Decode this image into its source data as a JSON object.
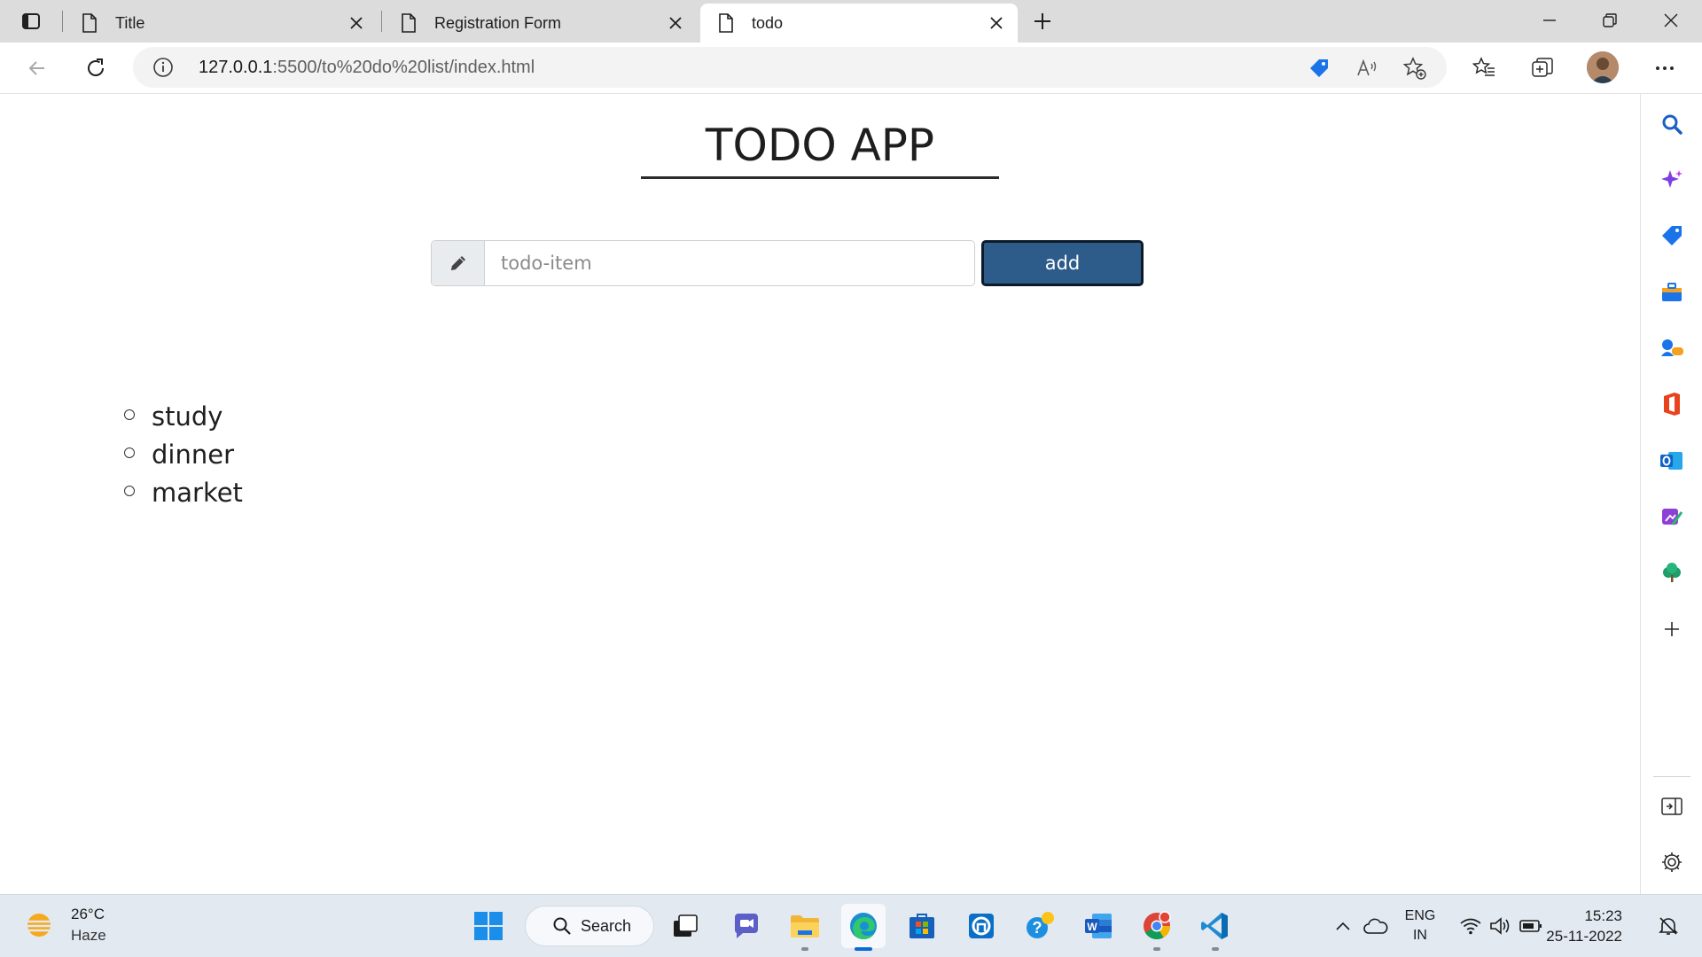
{
  "browser": {
    "tabs": [
      {
        "title": "Title",
        "active": false
      },
      {
        "title": "Registration Form",
        "active": false
      },
      {
        "title": "todo",
        "active": true
      }
    ],
    "address": {
      "host": "127.0.0.1",
      "path": ":5500/to%20do%20list/index.html"
    }
  },
  "page": {
    "app_title": "TODO APP",
    "input": {
      "placeholder": "todo-item",
      "value": ""
    },
    "add_button": "add",
    "todos": [
      "study",
      "dinner",
      "market"
    ]
  },
  "taskbar": {
    "weather": {
      "temp": "26°C",
      "condition": "Haze"
    },
    "search_label": "Search",
    "language": {
      "line1": "ENG",
      "line2": "IN"
    },
    "clock": {
      "time": "15:23",
      "date": "25-11-2022"
    }
  },
  "colors": {
    "add_button_bg": "#2d5b8a",
    "edge_accent": "#1067d6"
  }
}
